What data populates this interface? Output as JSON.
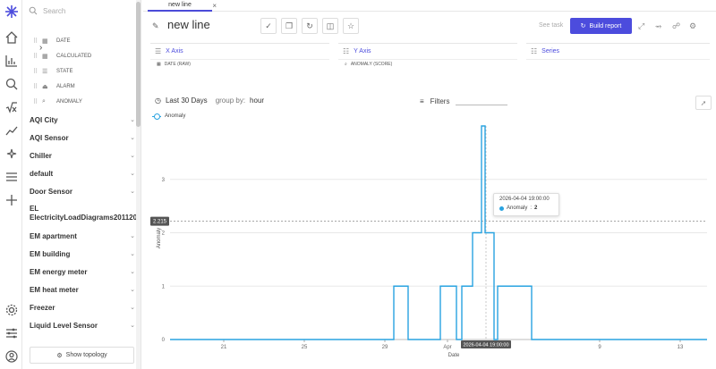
{
  "rail": {
    "icons": [
      "logo-icon",
      "home-icon",
      "bar-chart-icon",
      "search-icon",
      "formula-icon",
      "trend-icon",
      "sparkle-icon",
      "menu-icon",
      "plus-icon",
      "settings-icon",
      "sliders-icon",
      "user-icon"
    ]
  },
  "sidebar": {
    "search_placeholder": "Search",
    "fields": [
      {
        "label": "DATE",
        "icon": "calendar-icon",
        "glyph": "▦"
      },
      {
        "label": "CALCULATED",
        "icon": "calculator-icon",
        "glyph": "▦"
      },
      {
        "label": "STATE",
        "icon": "state-icon",
        "glyph": "☰"
      },
      {
        "label": "ALARM",
        "icon": "alarm-icon",
        "glyph": "⏏"
      },
      {
        "label": "ANOMALY",
        "icon": "anomaly-icon",
        "glyph": "⌕"
      }
    ],
    "groups": [
      "AQI City",
      "AQI Sensor",
      "Chiller",
      "default",
      "Door Sensor",
      "EL ElectricityLoadDiagrams2011201…",
      "EM apartment",
      "EM building",
      "EM energy meter",
      "EM heat meter",
      "Freezer",
      "Liquid Level Sensor"
    ],
    "show_topology": "Show topology"
  },
  "tab": {
    "label": "new line",
    "close": "×"
  },
  "header": {
    "title": "new line",
    "see_task": "See task",
    "build_report": "Build report"
  },
  "axes": {
    "x": {
      "title": "X Axis",
      "value": "DATE (RAW)"
    },
    "y": {
      "title": "Y Axis",
      "value": "ANOMALY (SCORE)"
    },
    "series": {
      "title": "Series"
    }
  },
  "controls": {
    "range": "Last 30 Days",
    "group_by_label": "group by:",
    "group_by_value": "hour",
    "filters": "Filters"
  },
  "chart_data": {
    "type": "line",
    "series": [
      {
        "name": "Anomaly",
        "color": "#29a3e0"
      }
    ],
    "xlabel": "Date",
    "ylabel": "Anomaly",
    "x_ticks": [
      "21",
      "25",
      "29",
      "Apr",
      "9",
      "13"
    ],
    "y_ticks": [
      "0",
      "1",
      "2",
      "3"
    ],
    "ylim": [
      0,
      4
    ],
    "cursor_label": "2.215",
    "cursor_x_label": "2026-04-04 19:00:00",
    "tooltip": {
      "date": "2026-04-04 19:00:00",
      "series": "Anomaly",
      "value": "2"
    },
    "line_points": [
      [
        0,
        0
      ],
      [
        12.5,
        0
      ],
      [
        12.5,
        1
      ],
      [
        13.3,
        1
      ],
      [
        13.3,
        0
      ],
      [
        15.1,
        0
      ],
      [
        15.1,
        1
      ],
      [
        16.0,
        1
      ],
      [
        16.0,
        0
      ],
      [
        16.3,
        0
      ],
      [
        16.3,
        1
      ],
      [
        16.9,
        1
      ],
      [
        16.9,
        2
      ],
      [
        17.4,
        2
      ],
      [
        17.4,
        4
      ],
      [
        17.6,
        4
      ],
      [
        17.6,
        2
      ],
      [
        18.1,
        2
      ],
      [
        18.1,
        0
      ],
      [
        18.3,
        0
      ],
      [
        18.3,
        1
      ],
      [
        18.7,
        1
      ],
      [
        18.7,
        1
      ],
      [
        20.2,
        1
      ],
      [
        20.2,
        0
      ],
      [
        30,
        0
      ]
    ]
  }
}
